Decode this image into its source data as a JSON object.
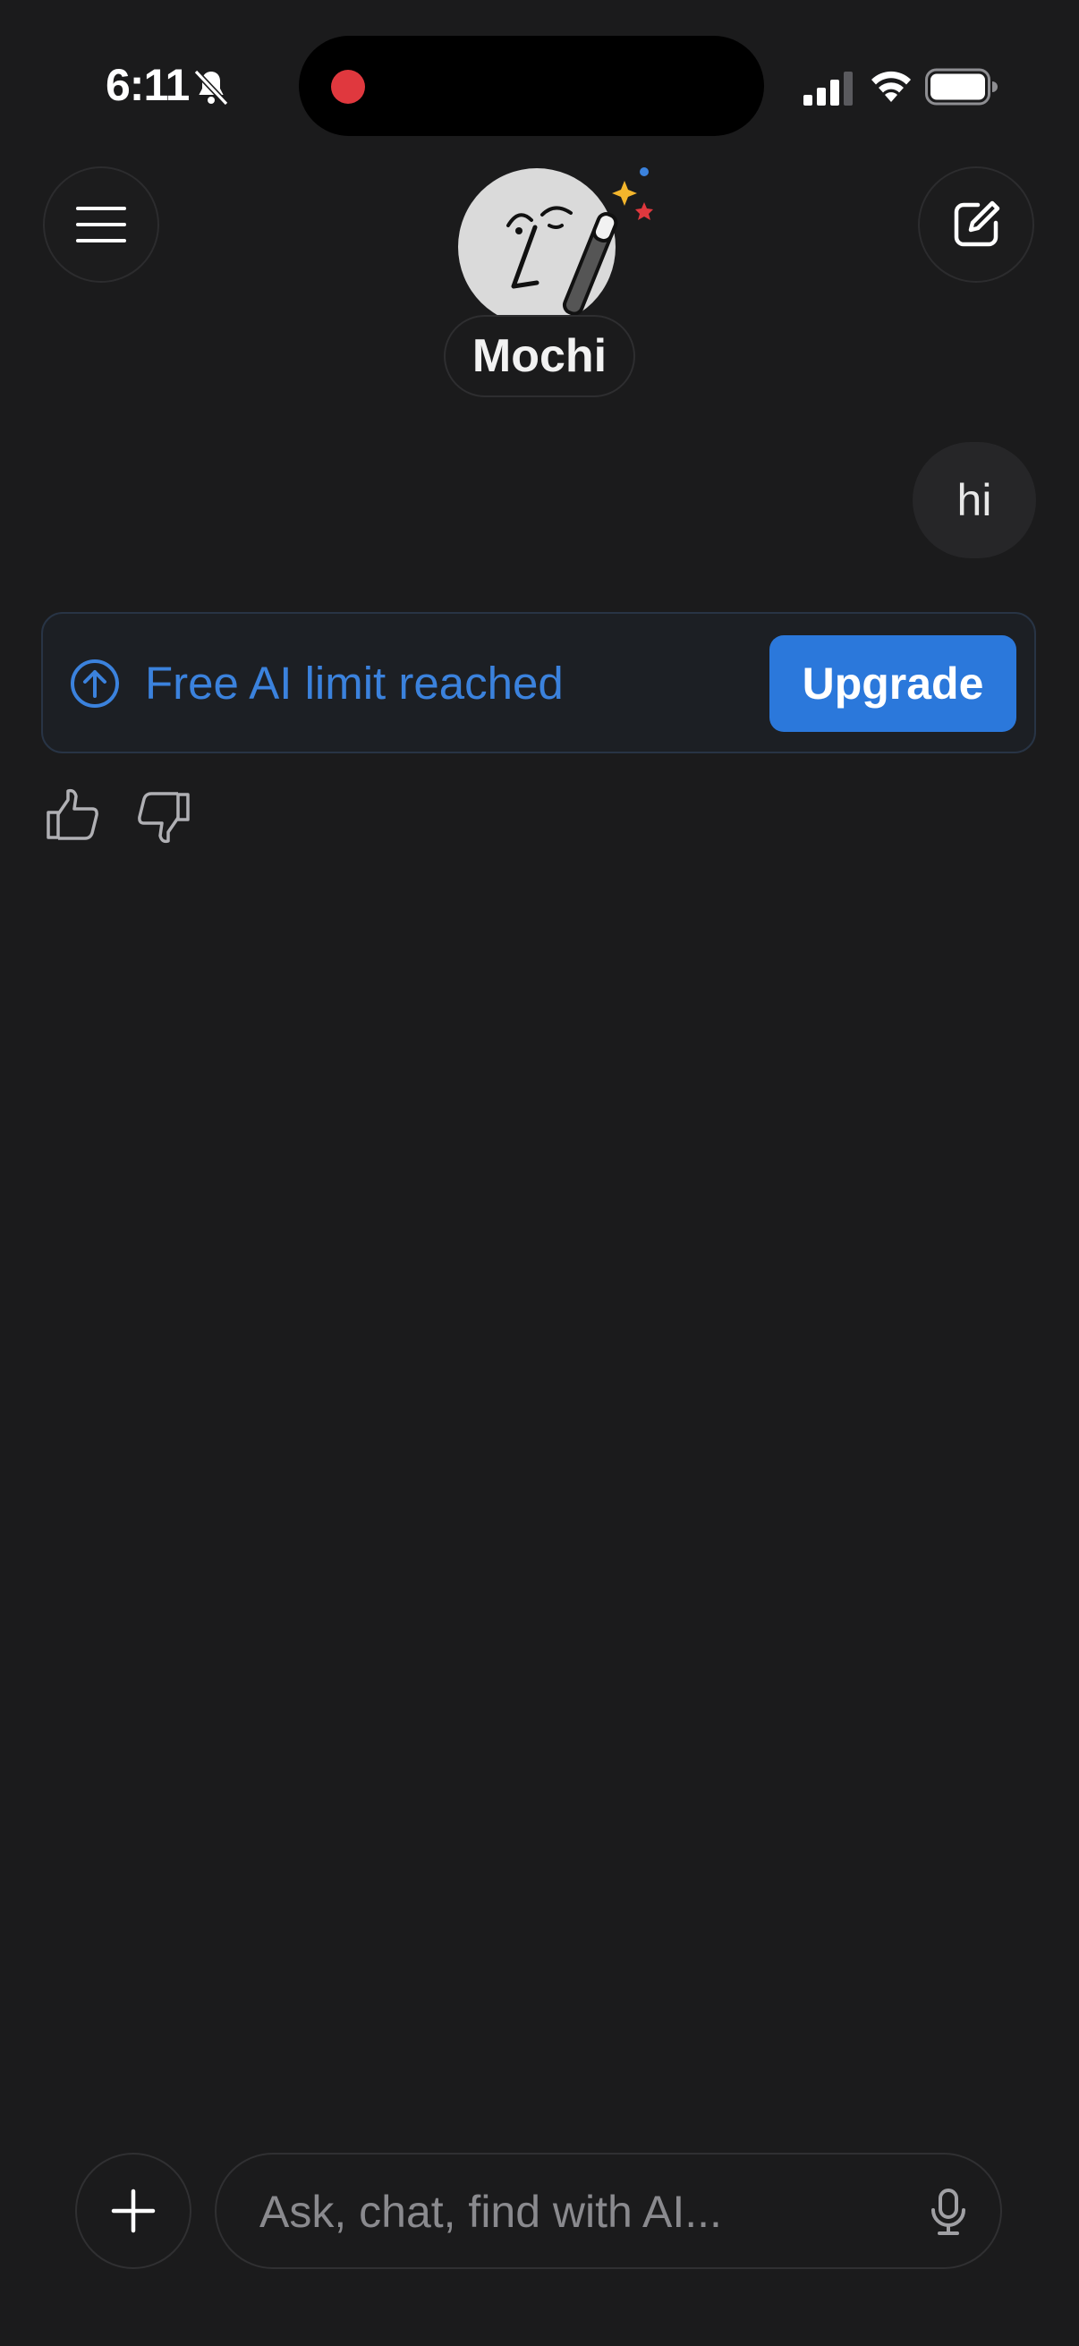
{
  "status_bar": {
    "time": "6:11",
    "icons": [
      "bell-slash-icon",
      "recording-indicator",
      "cellular-signal-icon",
      "wifi-icon",
      "battery-icon"
    ]
  },
  "header": {
    "menu_icon": "hamburger-menu-icon",
    "assistant_name": "Mochi",
    "avatar_icon": "mochi-face-with-magic-wand-icon",
    "compose_icon": "new-chat-compose-icon"
  },
  "chat": {
    "user_message": "hi",
    "limit_banner": {
      "icon": "arrow-up-circle-icon",
      "text": "Free AI limit reached",
      "button_label": "Upgrade"
    },
    "feedback": {
      "like_icon": "thumbs-up-icon",
      "dislike_icon": "thumbs-down-icon"
    }
  },
  "composer": {
    "add_icon": "plus-icon",
    "placeholder": "Ask, chat, find with AI...",
    "value": "",
    "mic_icon": "microphone-icon"
  },
  "colors": {
    "background": "#1b1b1c",
    "accent": "#2b78db",
    "banner_text": "#3b82dd",
    "recording": "#e0383e"
  }
}
